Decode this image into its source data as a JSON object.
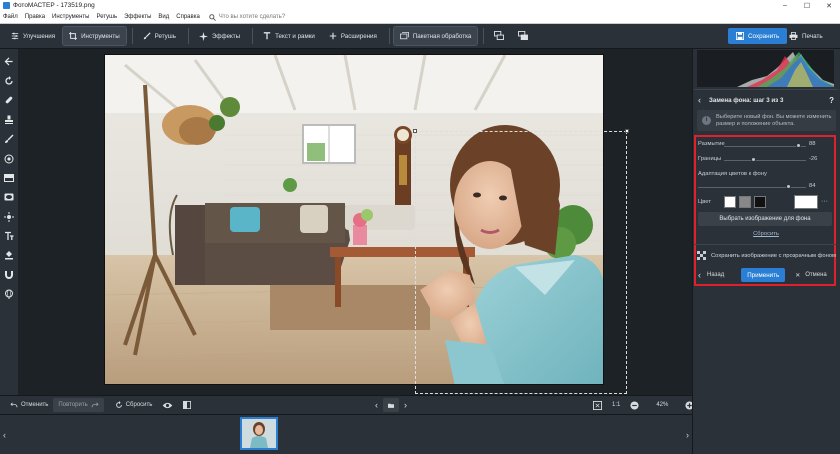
{
  "window": {
    "title": "ФотоМАСТЕР - 173519.png"
  },
  "menu": {
    "items": [
      "Файл",
      "Правка",
      "Инструменты",
      "Ретушь",
      "Эффекты",
      "Вид",
      "Справка"
    ],
    "search_placeholder": "Что вы хотите сделать?"
  },
  "toolbar": {
    "tabs": [
      {
        "label": "Улучшения",
        "icon": "sliders-icon"
      },
      {
        "label": "Инструменты",
        "icon": "crop-icon",
        "active": true
      },
      {
        "label": "Ретушь",
        "icon": "brush-icon"
      },
      {
        "label": "Эффекты",
        "icon": "sparkle-icon"
      },
      {
        "label": "Текст и рамки",
        "icon": "text-icon"
      },
      {
        "label": "Расширения",
        "icon": "plus-icon"
      },
      {
        "label": "Пакетная обработка",
        "icon": "batch-icon"
      }
    ],
    "save_label": "Сохранить",
    "print_label": "Печать"
  },
  "left_tools": [
    "back-arrow-icon",
    "rotate-icon",
    "healing-icon",
    "stamp-icon",
    "brush-icon",
    "radial-icon",
    "gradient-icon",
    "vignette-icon",
    "light-icon",
    "text-tool-icon",
    "fill-icon",
    "magnet-icon",
    "globe-icon"
  ],
  "bottom_bar": {
    "undo": "Отменить",
    "redo": "Повторить",
    "reset": "Сбросить",
    "zoom_ratio": "1:1",
    "zoom_percent": "42%"
  },
  "panel": {
    "step_title": "Замена фона: шаг 3 из 3",
    "help": "?",
    "hint_line1": "Выберите новый фон. Вы можете изменить",
    "hint_line2": "размер и положение объекта.",
    "blur_label": "Размытие",
    "blur_value": "88",
    "edges_label": "Границы",
    "edges_value": "-26",
    "adapt_label": "Адаптация цветов к фону",
    "adapt_value": "84",
    "color_label": "Цвет",
    "choose_bg_label": "Выбрать изображение для фона",
    "reset_link": "Сбросить",
    "save_transparent": "Сохранить изображение с прозрачным фоном",
    "back_label": "Назад",
    "apply_label": "Применить",
    "cancel_label": "Отмена",
    "sliders": {
      "blur": 0.92,
      "edges": 0.36,
      "adapt": 0.84
    },
    "swatches": [
      "#ffffff",
      "#888888",
      "#111111"
    ],
    "selected_color": "#ffffff"
  },
  "colors": {
    "accent": "#2a7fd4",
    "highlight_box": "#e0202a"
  }
}
